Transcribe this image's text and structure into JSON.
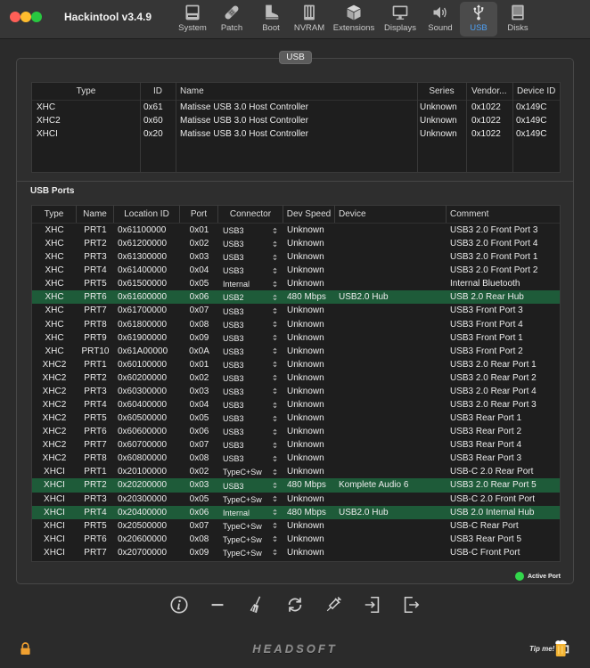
{
  "window": {
    "title": "Hackintool v3.4.9"
  },
  "toolbar": {
    "items": [
      {
        "label": "System",
        "icon": "system-icon"
      },
      {
        "label": "Patch",
        "icon": "bandage-icon"
      },
      {
        "label": "Boot",
        "icon": "boot-icon"
      },
      {
        "label": "NVRAM",
        "icon": "memory-chip-icon"
      },
      {
        "label": "Extensions",
        "icon": "package-icon"
      },
      {
        "label": "Displays",
        "icon": "monitor-icon"
      },
      {
        "label": "Sound",
        "icon": "speaker-icon"
      },
      {
        "label": "USB",
        "icon": "usb-icon",
        "selected": true
      },
      {
        "label": "Disks",
        "icon": "disk-icon"
      }
    ]
  },
  "panel": {
    "tab_label": "USB"
  },
  "controllers": {
    "columns": [
      "Type",
      "ID",
      "Name",
      "Series",
      "Vendor...",
      "Device ID"
    ],
    "rows": [
      {
        "type": "XHC",
        "id": "0x61",
        "name": "Matisse USB 3.0 Host Controller",
        "series": "Unknown",
        "vendor": "0x1022",
        "device_id": "0x149C"
      },
      {
        "type": "XHC2",
        "id": "0x60",
        "name": "Matisse USB 3.0 Host Controller",
        "series": "Unknown",
        "vendor": "0x1022",
        "device_id": "0x149C"
      },
      {
        "type": "XHCI",
        "id": "0x20",
        "name": "Matisse USB 3.0 Host Controller",
        "series": "Unknown",
        "vendor": "0x1022",
        "device_id": "0x149C"
      }
    ]
  },
  "ports": {
    "title": "USB Ports",
    "columns": [
      "Type",
      "Name",
      "Location ID",
      "Port",
      "Connector",
      "Dev Speed",
      "Device",
      "Comment"
    ],
    "rows": [
      {
        "type": "XHC",
        "name": "PRT1",
        "location_id": "0x61100000",
        "port": "0x01",
        "connector": "USB3",
        "dev_speed": "Unknown",
        "device": "",
        "comment": "USB3 2.0 Front Port 3",
        "active": false
      },
      {
        "type": "XHC",
        "name": "PRT2",
        "location_id": "0x61200000",
        "port": "0x02",
        "connector": "USB3",
        "dev_speed": "Unknown",
        "device": "",
        "comment": "USB3 2.0 Front Port 4",
        "active": false
      },
      {
        "type": "XHC",
        "name": "PRT3",
        "location_id": "0x61300000",
        "port": "0x03",
        "connector": "USB3",
        "dev_speed": "Unknown",
        "device": "",
        "comment": "USB3 2.0 Front Port 1",
        "active": false
      },
      {
        "type": "XHC",
        "name": "PRT4",
        "location_id": "0x61400000",
        "port": "0x04",
        "connector": "USB3",
        "dev_speed": "Unknown",
        "device": "",
        "comment": "USB3 2.0 Front Port 2",
        "active": false
      },
      {
        "type": "XHC",
        "name": "PRT5",
        "location_id": "0x61500000",
        "port": "0x05",
        "connector": "Internal",
        "dev_speed": "Unknown",
        "device": "",
        "comment": "Internal Bluetooth",
        "active": false
      },
      {
        "type": "XHC",
        "name": "PRT6",
        "location_id": "0x61600000",
        "port": "0x06",
        "connector": "USB2",
        "dev_speed": "480 Mbps",
        "device": "USB2.0 Hub",
        "comment": "USB 2.0 Rear Hub",
        "active": true
      },
      {
        "type": "XHC",
        "name": "PRT7",
        "location_id": "0x61700000",
        "port": "0x07",
        "connector": "USB3",
        "dev_speed": "Unknown",
        "device": "",
        "comment": "USB3 Front Port 3",
        "active": false
      },
      {
        "type": "XHC",
        "name": "PRT8",
        "location_id": "0x61800000",
        "port": "0x08",
        "connector": "USB3",
        "dev_speed": "Unknown",
        "device": "",
        "comment": "USB3 Front Port 4",
        "active": false
      },
      {
        "type": "XHC",
        "name": "PRT9",
        "location_id": "0x61900000",
        "port": "0x09",
        "connector": "USB3",
        "dev_speed": "Unknown",
        "device": "",
        "comment": "USB3 Front Port 1",
        "active": false
      },
      {
        "type": "XHC",
        "name": "PRT10",
        "location_id": "0x61A00000",
        "port": "0x0A",
        "connector": "USB3",
        "dev_speed": "Unknown",
        "device": "",
        "comment": "USB3 Front Port 2",
        "active": false
      },
      {
        "type": "XHC2",
        "name": "PRT1",
        "location_id": "0x60100000",
        "port": "0x01",
        "connector": "USB3",
        "dev_speed": "Unknown",
        "device": "",
        "comment": "USB3 2.0 Rear Port 1",
        "active": false
      },
      {
        "type": "XHC2",
        "name": "PRT2",
        "location_id": "0x60200000",
        "port": "0x02",
        "connector": "USB3",
        "dev_speed": "Unknown",
        "device": "",
        "comment": "USB3 2.0 Rear Port 2",
        "active": false
      },
      {
        "type": "XHC2",
        "name": "PRT3",
        "location_id": "0x60300000",
        "port": "0x03",
        "connector": "USB3",
        "dev_speed": "Unknown",
        "device": "",
        "comment": "USB3 2.0 Rear Port 4",
        "active": false
      },
      {
        "type": "XHC2",
        "name": "PRT4",
        "location_id": "0x60400000",
        "port": "0x04",
        "connector": "USB3",
        "dev_speed": "Unknown",
        "device": "",
        "comment": "USB3 2.0 Rear Port 3",
        "active": false
      },
      {
        "type": "XHC2",
        "name": "PRT5",
        "location_id": "0x60500000",
        "port": "0x05",
        "connector": "USB3",
        "dev_speed": "Unknown",
        "device": "",
        "comment": "USB3 Rear Port 1",
        "active": false
      },
      {
        "type": "XHC2",
        "name": "PRT6",
        "location_id": "0x60600000",
        "port": "0x06",
        "connector": "USB3",
        "dev_speed": "Unknown",
        "device": "",
        "comment": "USB3 Rear Port 2",
        "active": false
      },
      {
        "type": "XHC2",
        "name": "PRT7",
        "location_id": "0x60700000",
        "port": "0x07",
        "connector": "USB3",
        "dev_speed": "Unknown",
        "device": "",
        "comment": "USB3 Rear Port 4",
        "active": false
      },
      {
        "type": "XHC2",
        "name": "PRT8",
        "location_id": "0x60800000",
        "port": "0x08",
        "connector": "USB3",
        "dev_speed": "Unknown",
        "device": "",
        "comment": "USB3 Rear Port 3",
        "active": false
      },
      {
        "type": "XHCI",
        "name": "PRT1",
        "location_id": "0x20100000",
        "port": "0x02",
        "connector": "TypeC+Sw",
        "dev_speed": "Unknown",
        "device": "",
        "comment": "USB-C 2.0 Rear Port",
        "active": false
      },
      {
        "type": "XHCI",
        "name": "PRT2",
        "location_id": "0x20200000",
        "port": "0x03",
        "connector": "USB3",
        "dev_speed": "480 Mbps",
        "device": "Komplete Audio 6",
        "comment": "USB3 2.0 Rear Port 5",
        "active": true
      },
      {
        "type": "XHCI",
        "name": "PRT3",
        "location_id": "0x20300000",
        "port": "0x05",
        "connector": "TypeC+Sw",
        "dev_speed": "Unknown",
        "device": "",
        "comment": "USB-C 2.0 Front Port",
        "active": false
      },
      {
        "type": "XHCI",
        "name": "PRT4",
        "location_id": "0x20400000",
        "port": "0x06",
        "connector": "Internal",
        "dev_speed": "480 Mbps",
        "device": "USB2.0 Hub",
        "comment": "USB 2.0 Internal Hub",
        "active": true
      },
      {
        "type": "XHCI",
        "name": "PRT5",
        "location_id": "0x20500000",
        "port": "0x07",
        "connector": "TypeC+Sw",
        "dev_speed": "Unknown",
        "device": "",
        "comment": "USB-C Rear Port",
        "active": false
      },
      {
        "type": "XHCI",
        "name": "PRT6",
        "location_id": "0x20600000",
        "port": "0x08",
        "connector": "TypeC+Sw",
        "dev_speed": "Unknown",
        "device": "",
        "comment": "USB3 Rear Port 5",
        "active": false
      },
      {
        "type": "XHCI",
        "name": "PRT7",
        "location_id": "0x20700000",
        "port": "0x09",
        "connector": "TypeC+Sw",
        "dev_speed": "Unknown",
        "device": "",
        "comment": "USB-C Front Port",
        "active": false
      }
    ]
  },
  "legend": {
    "active_port": "Active Port"
  },
  "actions": [
    {
      "icon": "info-icon"
    },
    {
      "icon": "minus-icon"
    },
    {
      "icon": "broom-icon"
    },
    {
      "icon": "refresh-icon"
    },
    {
      "icon": "syringe-icon"
    },
    {
      "icon": "import-icon"
    },
    {
      "icon": "export-icon"
    }
  ],
  "footer": {
    "logo": "HEADSOFT",
    "tip": "Tip me!",
    "lock_icon": "lock-icon",
    "tip_icon": "beer-mug-icon"
  },
  "colors": {
    "active_row": "#1e5b39",
    "active_dot": "#32d74b",
    "selected_toolbar_label": "#4ea1f5",
    "lock": "#f0a030"
  }
}
